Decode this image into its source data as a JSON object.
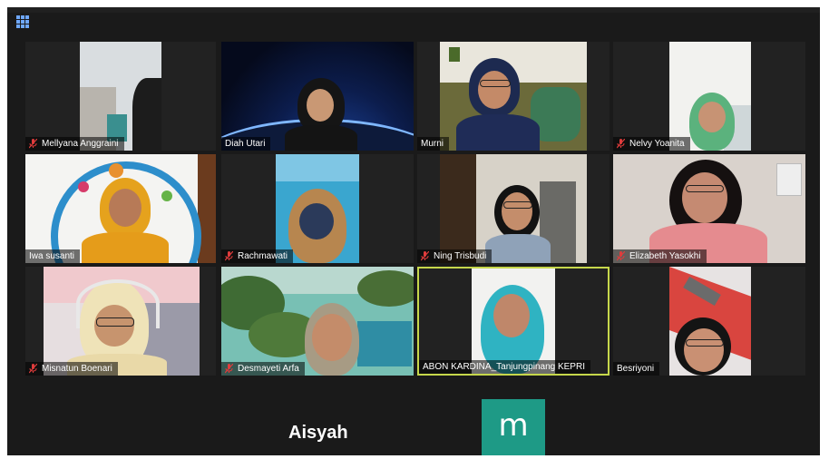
{
  "meeting": {
    "colors": {
      "background": "#1a1a1a",
      "active_speaker_border": "#c6d74b",
      "muted_icon": "#e03c3c",
      "avatar_tile": "#1e9a86"
    },
    "view_icon": "gallery-grid-icon"
  },
  "participants": [
    {
      "name": "Mellyana Anggraini",
      "muted": true
    },
    {
      "name": "Diah Utari",
      "muted": false
    },
    {
      "name": "Murni",
      "muted": false
    },
    {
      "name": "Nelvy Yoanita",
      "muted": true
    },
    {
      "name": "Iwa susanti",
      "muted": false
    },
    {
      "name": "Rachmawati",
      "muted": true
    },
    {
      "name": "Ning Trisbudi",
      "muted": true
    },
    {
      "name": "Elizabeth Yasokhi",
      "muted": true
    },
    {
      "name": "Misnatun Boenari",
      "muted": true
    },
    {
      "name": "Desmayeti Arfa",
      "muted": true
    },
    {
      "name": "ABON KARDINA_Tanjungpinang KEPRI",
      "muted": false,
      "active_speaker": true
    },
    {
      "name": "Besriyoni",
      "muted": false
    }
  ],
  "no_video_tiles": [
    {
      "name": "Aisyah"
    },
    {
      "avatar_letter": "m"
    }
  ]
}
